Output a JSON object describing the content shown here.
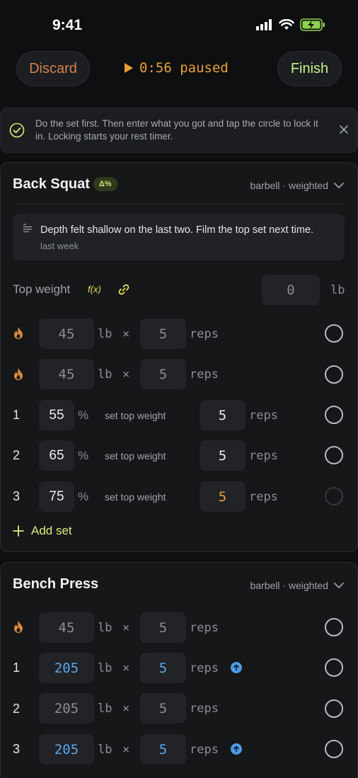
{
  "status_bar": {
    "time": "9:41"
  },
  "top_bar": {
    "discard_label": "Discard",
    "finish_label": "Finish",
    "timer_text": "0:56 paused"
  },
  "tip": {
    "text": "Do the set first. Then enter what you got and tap the circle to lock it in. Locking starts your rest timer."
  },
  "exercises": [
    {
      "name": "Back Squat",
      "badge": "Δ%",
      "meta": "barbell · weighted",
      "note": {
        "text": "Depth felt shallow on the last two. Film the top set next time.",
        "sub": "last week"
      },
      "top_weight": {
        "label": "Top weight",
        "formula": "f(x)",
        "value": "0",
        "unit": "lb"
      },
      "warmups": [
        {
          "weight": "45",
          "unit": "lb",
          "times": "×",
          "reps": "5",
          "reps_label": "reps"
        },
        {
          "weight": "45",
          "unit": "lb",
          "times": "×",
          "reps": "5",
          "reps_label": "reps"
        }
      ],
      "sets": [
        {
          "num": "1",
          "pct": "55",
          "pct_sign": "%",
          "hint": "set top weight",
          "reps": "5",
          "reps_label": "reps"
        },
        {
          "num": "2",
          "pct": "65",
          "pct_sign": "%",
          "hint": "set top weight",
          "reps": "5",
          "reps_label": "reps"
        },
        {
          "num": "3",
          "pct": "75",
          "pct_sign": "%",
          "hint": "set top weight",
          "reps": "5",
          "reps_label": "reps"
        }
      ],
      "add_set_label": "Add set"
    },
    {
      "name": "Bench Press",
      "meta": "barbell · weighted",
      "warmups": [
        {
          "weight": "45",
          "unit": "lb",
          "times": "×",
          "reps": "5",
          "reps_label": "reps"
        }
      ],
      "sets": [
        {
          "num": "1",
          "weight": "205",
          "unit": "lb",
          "times": "×",
          "reps": "5",
          "reps_label": "reps"
        },
        {
          "num": "2",
          "weight": "205",
          "unit": "lb",
          "times": "×",
          "reps": "5",
          "reps_label": "reps"
        },
        {
          "num": "3",
          "weight": "205",
          "unit": "lb",
          "times": "×",
          "reps": "5",
          "reps_label": "reps"
        }
      ]
    }
  ]
}
